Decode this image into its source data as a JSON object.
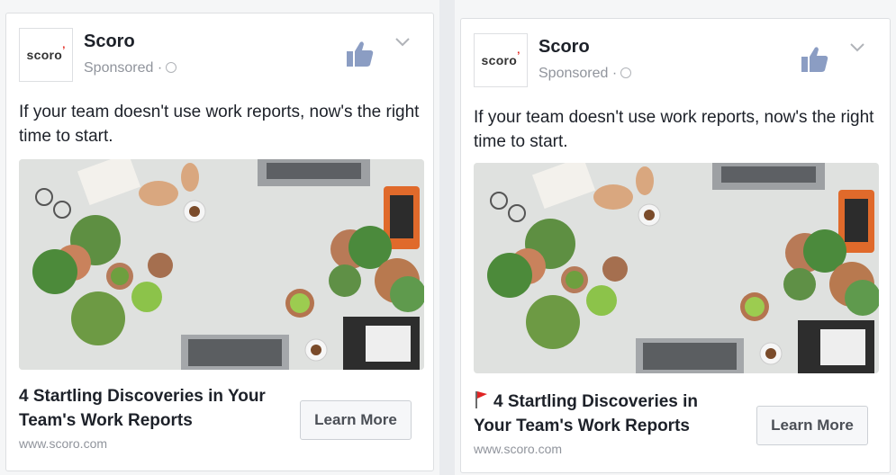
{
  "ads": [
    {
      "page_name": "Scoro",
      "sponsored": "Sponsored ·",
      "logo_text": "scoro",
      "body_text": "If your team doesn't use work reports, now's the right time to start.",
      "headline": "4 Startling Discoveries in Your Team's Work Reports",
      "url": "www.scoro.com",
      "cta_label": "Learn More",
      "icons": [
        "like-icon",
        "chevron-down-icon",
        "globe-icon"
      ]
    },
    {
      "page_name": "Scoro",
      "sponsored": "Sponsored ·",
      "logo_text": "scoro",
      "body_text": "If your team doesn't use work reports, now's the right time to start.",
      "headline": "4 Startling Discoveries in Your Team's Work Reports",
      "url": "www.scoro.com",
      "cta_label": "Learn More",
      "icons": [
        "like-icon",
        "chevron-down-icon",
        "globe-icon",
        "red-flag-icon"
      ]
    }
  ],
  "colors": {
    "brand_red": "#e2231a",
    "link_gray": "#90949c",
    "text": "#1d2129",
    "like_blue": "#8b9dc3"
  }
}
